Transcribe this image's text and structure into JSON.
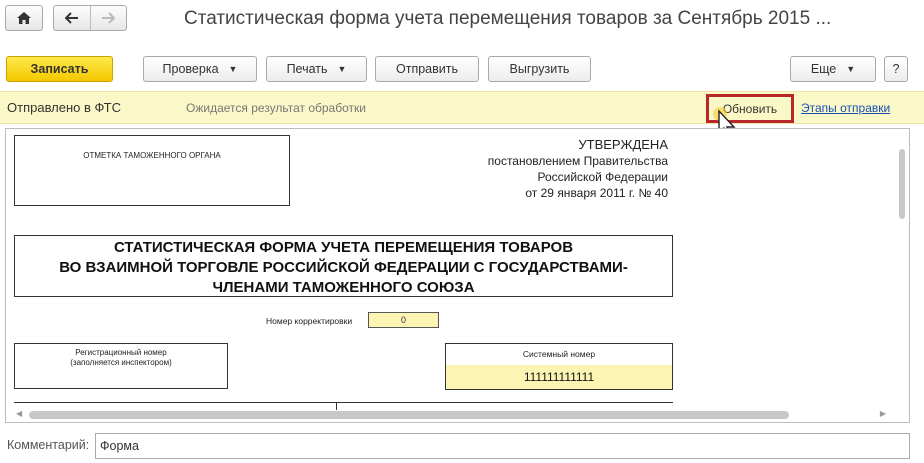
{
  "window": {
    "title": "Статистическая форма учета перемещения товаров за Сентябрь 2015 ...",
    "home_icon": "home-icon",
    "back_icon": "arrow-left-icon",
    "forward_icon": "arrow-right-icon"
  },
  "toolbar": {
    "save_label": "Записать",
    "check_label": "Проверка",
    "print_label": "Печать",
    "send_label": "Отправить",
    "export_label": "Выгрузить",
    "more_label": "Еще",
    "help_label": "?"
  },
  "status": {
    "state": "Отправлено в ФТС",
    "message": "Ожидается результат обработки",
    "refresh_label": "Обновить",
    "stages_link": "Этапы отправки",
    "highlight_color": "#b8262c"
  },
  "document": {
    "stamp_label": "ОТМЕТКА ТАМОЖЕННОГО ОРГАНА",
    "approved": {
      "head": "УТВЕРЖДЕНА",
      "line1": "постановлением Правительства",
      "line2": "Российской Федерации",
      "line3": "от 29 января 2011 г. № 40"
    },
    "form_title": {
      "line1": "СТАТИСТИЧЕСКАЯ ФОРМА УЧЕТА ПЕРЕМЕЩЕНИЯ ТОВАРОВ",
      "line2": "ВО ВЗАИМНОЙ ТОРГОВЛЕ РОССИЙСКОЙ ФЕДЕРАЦИИ С ГОСУДАРСТВАМИ-",
      "line3": "ЧЛЕНАМИ ТАМОЖЕННОГО СОЮЗА"
    },
    "correction_label": "Номер корректировки",
    "correction_value": "0",
    "registration": {
      "line1": "Регистрационный номер",
      "line2": "(заполняется инспектором)"
    },
    "system_number_label": "Системный номер",
    "system_number_value": "111111111111"
  },
  "comment": {
    "label": "Комментарий:",
    "value": "Форма"
  }
}
